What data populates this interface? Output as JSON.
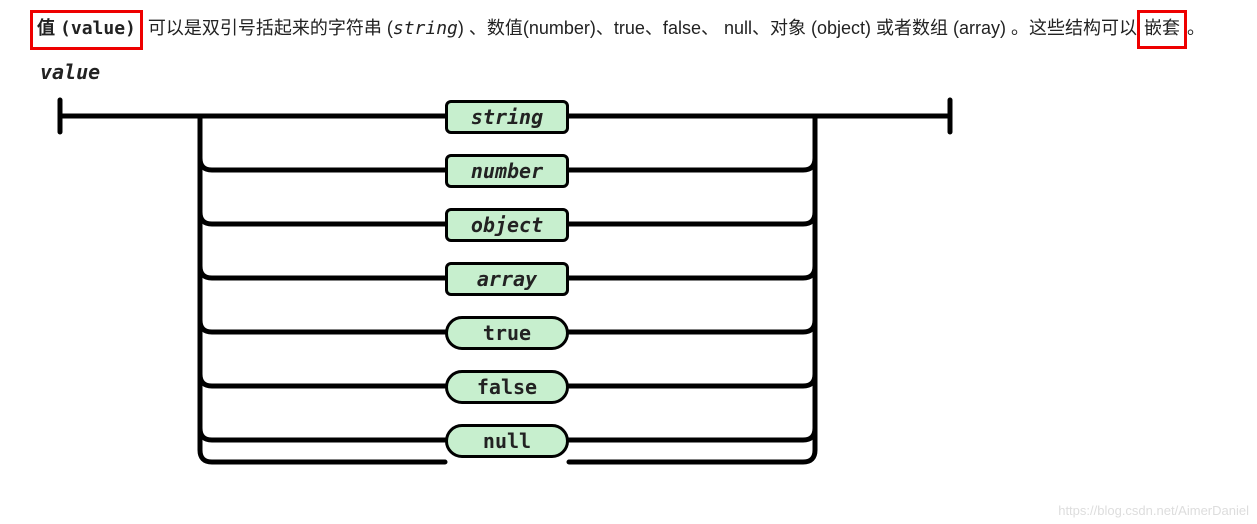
{
  "description": {
    "lead_cn": "值",
    "lead_value": "(value)",
    "part1": " 可以是双引号括起来的字符串 (",
    "string_it": "string",
    "part2": ") 、数值(number)、true、false、 null、对象 (object) 或者数组 (array) 。这些结构可以",
    "nest": "嵌套",
    "part3": "。"
  },
  "title": "value",
  "nodes": {
    "n0": "string",
    "n1": "number",
    "n2": "object",
    "n3": "array",
    "n4": "true",
    "n5": "false",
    "n6": "null"
  },
  "watermark": "https://blog.csdn.net/AimerDaniel"
}
